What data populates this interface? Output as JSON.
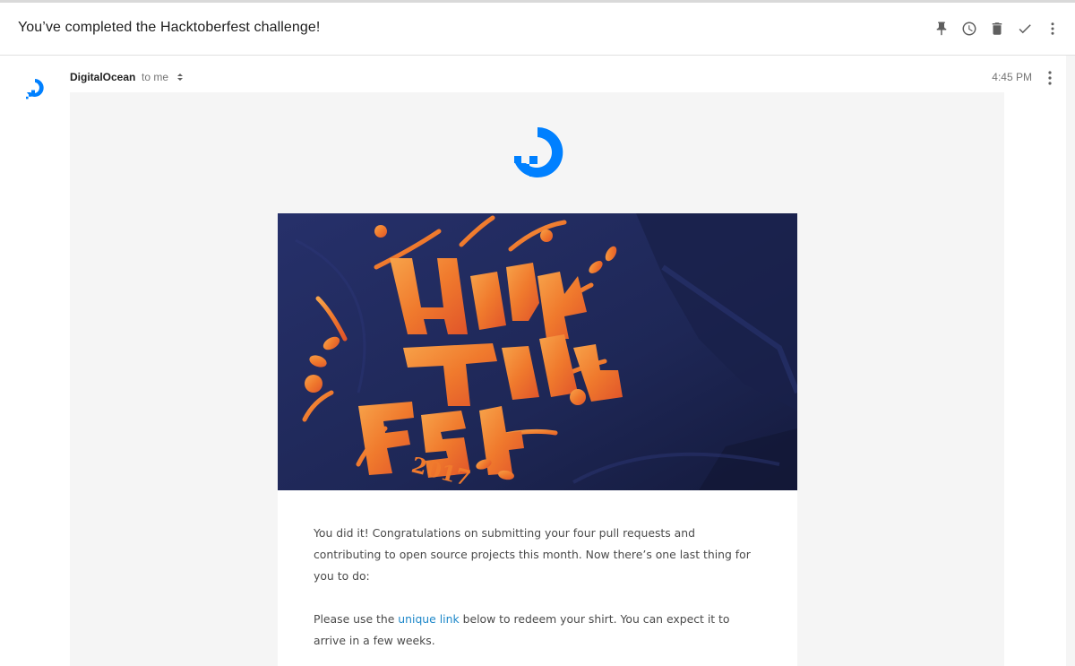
{
  "subject": "You’ve completed the Hacktoberfest challenge!",
  "toolbar": {
    "icons": [
      "pin-icon",
      "snooze-clock-icon",
      "trash-icon",
      "checkmark-icon",
      "more-vert-icon"
    ]
  },
  "message": {
    "sender_name": "DigitalOcean",
    "recipient": "to me",
    "time": "4:45 PM"
  },
  "body": {
    "hero_year": "2017",
    "paragraph1": "You did it! Congratulations on submitting your four pull requests and contributing to open source projects this month. Now there’s one last thing for you to do:",
    "paragraph2_before": "Please use the ",
    "paragraph2_link": "unique link",
    "paragraph2_after": " below to redeem your shirt. You can expect it to arrive in a few weeks."
  },
  "colors": {
    "brand_blue": "#0080ff",
    "link_blue": "#1c87c9",
    "shirt_navy": "#1d2650",
    "print_orange": "#f07a2d",
    "body_bg": "#f5f5f5"
  }
}
